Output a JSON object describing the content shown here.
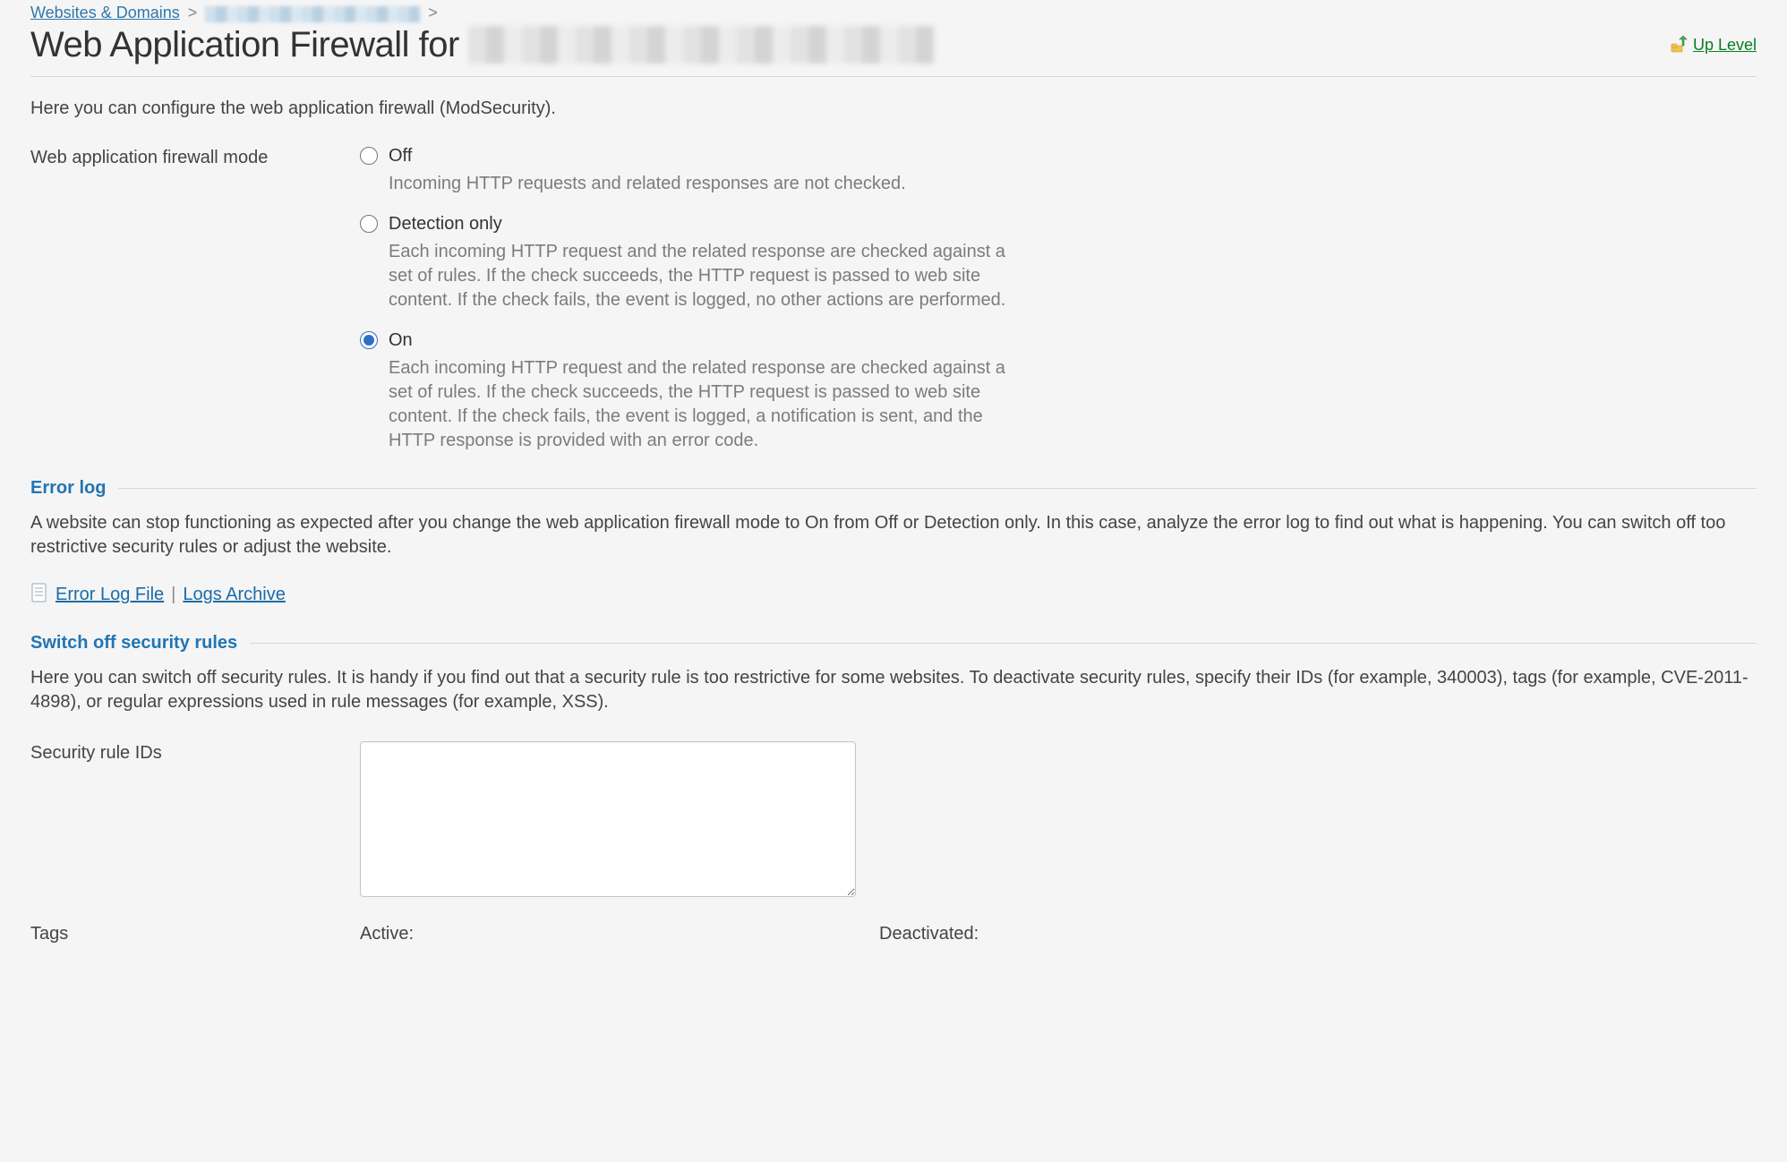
{
  "breadcrumb": {
    "root": "Websites & Domains",
    "sep": ">"
  },
  "title": "Web Application Firewall for",
  "uplevel": "Up Level",
  "intro": "Here you can configure the web application firewall (ModSecurity).",
  "mode_label": "Web application firewall mode",
  "modes": {
    "off": {
      "label": "Off",
      "desc": "Incoming HTTP requests and related responses are not checked."
    },
    "detection": {
      "label": "Detection only",
      "desc": "Each incoming HTTP request and the related response are checked against a set of rules. If the check succeeds, the HTTP request is passed to web site content. If the check fails, the event is logged, no other actions are performed."
    },
    "on": {
      "label": "On",
      "desc": "Each incoming HTTP request and the related response are checked against a set of rules. If the check succeeds, the HTTP request is passed to web site content. If the check fails, the event is logged, a notification is sent, and the HTTP response is provided with an error code."
    }
  },
  "selected_mode": "on",
  "errorlog": {
    "title": "Error log",
    "text": "A website can stop functioning as expected after you change the web application firewall mode to On from Off or Detection only. In this case, analyze the error log to find out what is happening. You can switch off too restrictive security rules or adjust the website.",
    "file_link": "Error Log File",
    "archive_link": "Logs Archive"
  },
  "switchoff": {
    "title": "Switch off security rules",
    "text": "Here you can switch off security rules. It is handy if you find out that a security rule is too restrictive for some websites. To deactivate security rules, specify their IDs (for example, 340003), tags (for example, CVE-2011-4898), or regular expressions used in rule messages (for example, XSS).",
    "ids_label": "Security rule IDs",
    "tags_label": "Tags",
    "active_label": "Active:",
    "deactivated_label": "Deactivated:"
  }
}
